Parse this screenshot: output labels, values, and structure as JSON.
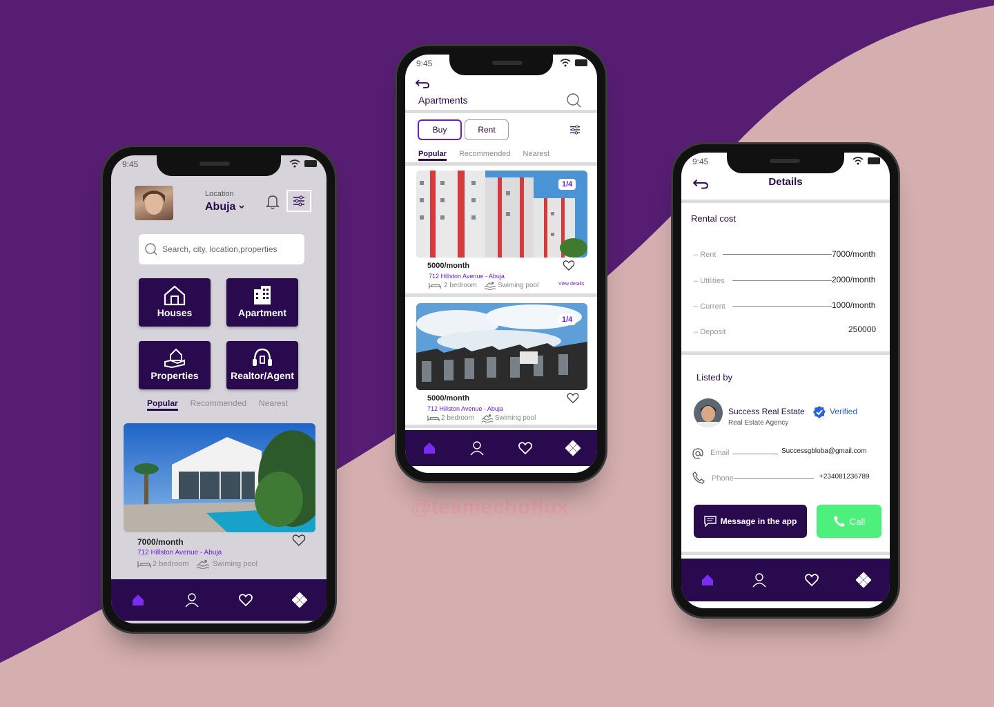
{
  "colors": {
    "brand": "#2a0a4e",
    "accent": "#6b1cd6",
    "background_purple": "#561d72",
    "background_pink": "#d5aeaf",
    "call_green": "#4ef07d"
  },
  "watermark": "@teamechoflux",
  "phone1": {
    "time": "9:45",
    "location_label": "Location",
    "location_value": "Abuja",
    "search_placeholder": "Search, city, location,properties",
    "categories": [
      "Houses",
      "Apartment",
      "Properties",
      "Realtor/Agent"
    ],
    "tabs": [
      "Popular",
      "Recommended",
      "Nearest"
    ],
    "listing": {
      "price": "7000/month",
      "address": "712 Hillston Avenue - Abuja",
      "bedrooms": "2 bedroom",
      "amenity": "Swiming pool"
    },
    "nav": [
      "home-icon",
      "user-icon",
      "heart-icon",
      "grid-icon"
    ]
  },
  "phone2": {
    "time": "9:45",
    "title": "Apartments",
    "toggle": [
      "Buy",
      "Rent"
    ],
    "tabs": [
      "Popular",
      "Recommended",
      "Nearest"
    ],
    "listings": [
      {
        "badge": "1/4",
        "price": "5000/month",
        "address": "712 Hillston Avenue - Abuja",
        "bedrooms": "2 bedroom",
        "amenity": "Swiming pool",
        "link": "View details"
      },
      {
        "badge": "1/4",
        "price": "5000/month",
        "address": "712 Hillston Avenue - Abuja",
        "bedrooms": "2 bedroom",
        "amenity": "Swiming pool"
      }
    ]
  },
  "phone3": {
    "time": "9:45",
    "title": "Details",
    "rental_heading": "Rental cost",
    "costs": [
      {
        "label": "Rent",
        "value": "7000/month"
      },
      {
        "label": "Utilities",
        "value": "2000/month"
      },
      {
        "label": "Current",
        "value": "1000/month"
      },
      {
        "label": "Deposit",
        "value": "250000"
      }
    ],
    "listed_heading": "Listed by",
    "agent_name": "Success Real Estate",
    "verified": "Verified",
    "agent_type": "Real Estate Agency",
    "email_label": "Email",
    "email_value": "Successgbloba@gmail.com",
    "phone_label": "Phone",
    "phone_value": "+234081236789",
    "message_button": "Message in the app",
    "call_button": "Call"
  }
}
